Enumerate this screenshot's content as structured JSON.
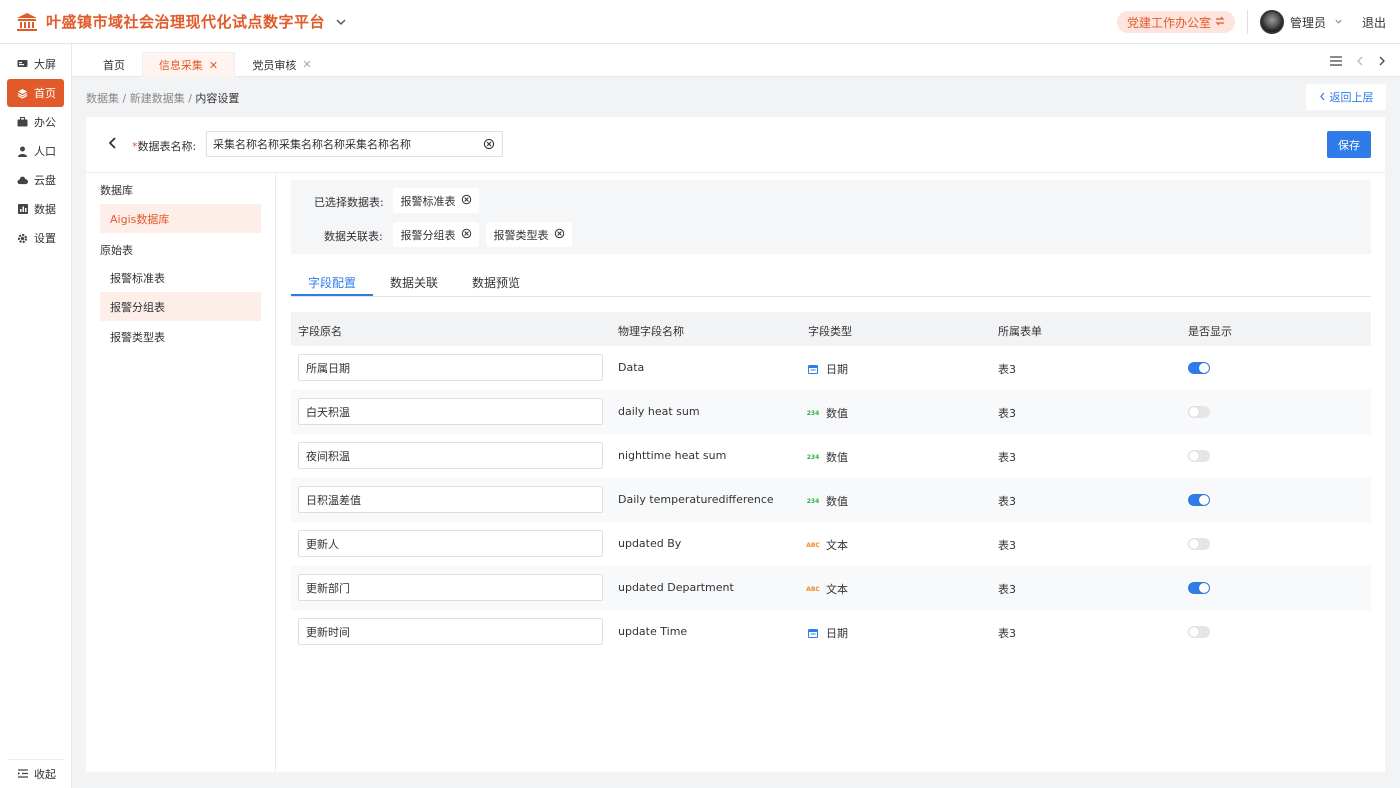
{
  "header": {
    "app_title": "叶盛镇市域社会治理现代化试点数字平台",
    "office_button": "党建工作办公室",
    "user_name": "管理员",
    "logout": "退出"
  },
  "sidebar": {
    "items": [
      {
        "label": "大屏",
        "icon": "screen-icon"
      },
      {
        "label": "首页",
        "icon": "layers-icon",
        "active": true
      },
      {
        "label": "办公",
        "icon": "briefcase-icon"
      },
      {
        "label": "人口",
        "icon": "person-icon"
      },
      {
        "label": "云盘",
        "icon": "cloud-icon"
      },
      {
        "label": "数据",
        "icon": "chart-icon"
      },
      {
        "label": "设置",
        "icon": "gear-icon"
      }
    ],
    "collapse": "收起"
  },
  "tabs": [
    {
      "label": "首页",
      "closable": false
    },
    {
      "label": "信息采集",
      "closable": true,
      "active": true
    },
    {
      "label": "党员审核",
      "closable": true
    }
  ],
  "breadcrumb": [
    "数据集",
    "新建数据集",
    "内容设置"
  ],
  "back_up": "返回上层",
  "form": {
    "name_label": "数据表名称:",
    "name_value": "采集名称名称采集名称名称采集名称名称",
    "save": "保存"
  },
  "left_panel": {
    "db_heading": "数据库",
    "db_item": "Aigis数据库",
    "raw_heading": "原始表",
    "tables": [
      "报警标准表",
      "报警分组表",
      "报警类型表"
    ],
    "selected_table": "报警分组表"
  },
  "selection": {
    "selected_label": "已选择数据表:",
    "selected_tables": [
      "报警标准表"
    ],
    "related_label": "数据关联表:",
    "related_tables": [
      "报警分组表",
      "报警类型表"
    ]
  },
  "subtabs": [
    "字段配置",
    "数据关联",
    "数据预览"
  ],
  "table": {
    "headers": [
      "字段原名",
      "物理字段名称",
      "字段类型",
      "所属表单",
      "是否显示"
    ],
    "rows": [
      {
        "name": "所属日期",
        "physical": "Data",
        "type": "日期",
        "type_icon": "calendar-icon",
        "form": "表3",
        "show": true
      },
      {
        "name": "白天积温",
        "physical": "daily heat sum",
        "type": "数值",
        "type_icon": "number-icon",
        "form": "表3",
        "show": false
      },
      {
        "name": "夜间积温",
        "physical": "nighttime heat sum",
        "type": "数值",
        "type_icon": "number-icon",
        "form": "表3",
        "show": false
      },
      {
        "name": "日积温差值",
        "physical": "Daily temperaturedifference",
        "type": "数值",
        "type_icon": "number-icon",
        "form": "表3",
        "show": true
      },
      {
        "name": "更新人",
        "physical": "updated By",
        "type": "文本",
        "type_icon": "text-icon",
        "form": "表3",
        "show": false
      },
      {
        "name": "更新部门",
        "physical": "updated Department",
        "type": "文本",
        "type_icon": "text-icon",
        "form": "表3",
        "show": true
      },
      {
        "name": "更新时间",
        "physical": "update Time",
        "type": "日期",
        "type_icon": "calendar-icon",
        "form": "表3",
        "show": false
      }
    ]
  },
  "icon_glyphs": {
    "number": "234",
    "text": "ABC"
  },
  "colors": {
    "brand": "#e15b2a",
    "primary": "#2f7ce8",
    "number_icon": "#2fb344",
    "text_icon": "#f08a24"
  }
}
